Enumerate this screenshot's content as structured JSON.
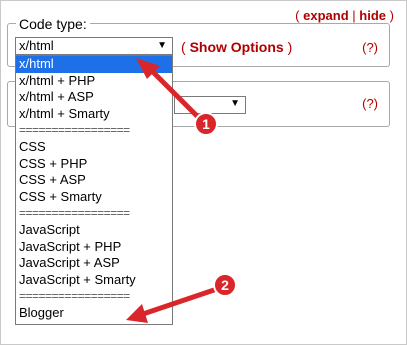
{
  "header_links": {
    "open_paren": "(",
    "expand": "expand",
    "separator": "|",
    "hide": "hide",
    "close_paren": ")"
  },
  "code_type": {
    "legend": "Code type:",
    "selected_value": "x/html",
    "show_options": "Show Options",
    "open_paren": "(",
    "close_paren": ")",
    "help": "(?)"
  },
  "second_field": {
    "help": "(?)"
  },
  "dropdown_options": [
    {
      "label": "x/html",
      "selected": true
    },
    {
      "label": "x/html + PHP"
    },
    {
      "label": "x/html + ASP"
    },
    {
      "label": "x/html + Smarty"
    },
    {
      "label": "=================",
      "divider": true
    },
    {
      "label": "CSS"
    },
    {
      "label": "CSS + PHP"
    },
    {
      "label": "CSS + ASP"
    },
    {
      "label": "CSS + Smarty"
    },
    {
      "label": "=================",
      "divider": true
    },
    {
      "label": "JavaScript"
    },
    {
      "label": "JavaScript + PHP"
    },
    {
      "label": "JavaScript + ASP"
    },
    {
      "label": "JavaScript + Smarty"
    },
    {
      "label": "=================",
      "divider": true
    },
    {
      "label": "Blogger"
    }
  ],
  "annotations": {
    "marker_1": "1",
    "marker_2": "2",
    "color": "#d9262a"
  },
  "colors": {
    "link": "#b00000",
    "selection": "#1e70e8"
  }
}
